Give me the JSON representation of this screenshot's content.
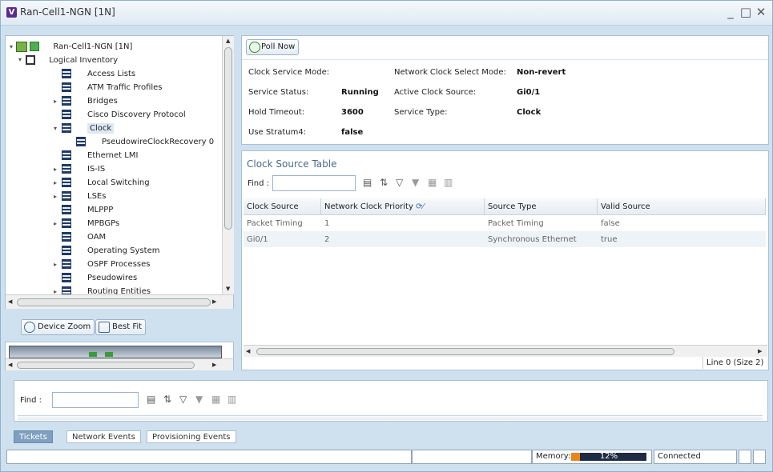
{
  "window": {
    "title": "Ran-Cell1-NGN [1N]",
    "icon_letter": "V",
    "min": "_",
    "max": "□",
    "close": "✕"
  },
  "tree": {
    "root": "Ran-Cell1-NGN [1N]",
    "logical": "Logical Inventory",
    "items": [
      "Access Lists",
      "ATM Traffic Profiles",
      "Bridges",
      "Cisco Discovery Protocol",
      "Clock",
      "PseudowireClockRecovery 0",
      "Ethernet LMI",
      "IS-IS",
      "Local Switching",
      "LSEs",
      "MLPPP",
      "MPBGPs",
      "OAM",
      "Operating System",
      "OSPF Processes",
      "Pseudowires",
      "Routing Entities"
    ]
  },
  "zoom": {
    "device_zoom": "Device Zoom",
    "best_fit": "Best Fit"
  },
  "clock": {
    "poll_now": "Poll Now",
    "fields": {
      "clock_service_mode_label": "Clock Service Mode:",
      "clock_service_mode_value": "",
      "network_clock_select_mode_label": "Network Clock Select Mode:",
      "network_clock_select_mode_value": "Non-revert",
      "service_status_label": "Service Status:",
      "service_status_value": "Running",
      "active_clock_source_label": "Active Clock Source:",
      "active_clock_source_value": "Gi0/1",
      "hold_timeout_label": "Hold Timeout:",
      "hold_timeout_value": "3600",
      "service_type_label": "Service Type:",
      "service_type_value": "Clock",
      "use_stratum4_label": "Use Stratum4:",
      "use_stratum4_value": "false"
    }
  },
  "clock_table": {
    "title": "Clock Source Table",
    "find_label": "Find :",
    "columns": [
      "Clock Source",
      "Network Clock Priority",
      "Source Type",
      "Valid Source"
    ],
    "rows": [
      [
        "Packet Timing",
        "1",
        "Packet Timing",
        "false"
      ],
      [
        "Gi0/1",
        "2",
        "Synchronous Ethernet",
        "true"
      ]
    ],
    "status": "Line 0 (Size 2)"
  },
  "bottom": {
    "find_label": "Find :",
    "tabs": [
      "Tickets",
      "Network Events",
      "Provisioning Events"
    ]
  },
  "statusbar": {
    "memory_label": "Memory:",
    "memory_pct": "12%",
    "memory_fraction": 0.12,
    "connection": "Connected"
  },
  "colors": {
    "accent": "#7f9fbf",
    "memory_bar": "#e8841c",
    "memory_track": "#1f2a44"
  }
}
